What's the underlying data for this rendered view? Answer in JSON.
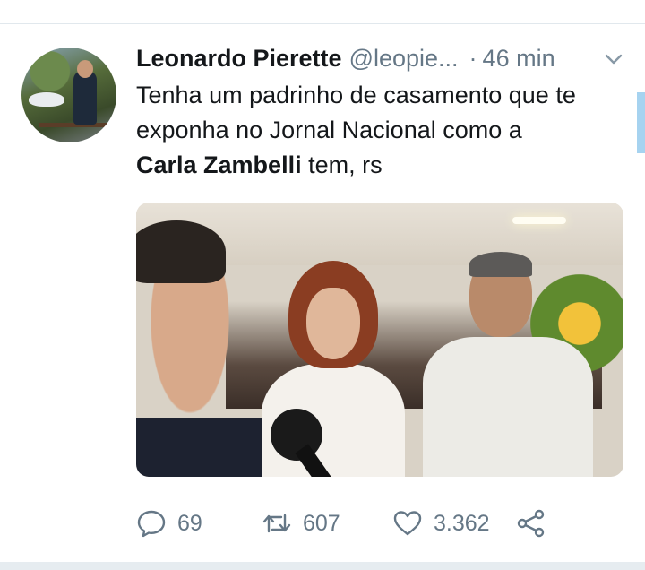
{
  "tweet": {
    "author_name": "Leonardo Pierette",
    "author_handle": "@leopie...",
    "separator": "·",
    "time": "46 min",
    "text_line1": "Tenha um padrinho de casamento que te",
    "text_line2": "exponha no Jornal Nacional como a",
    "text_bold": "Carla Zambelli",
    "text_tail": " tem, rs"
  },
  "actions": {
    "reply_count": "69",
    "retweet_count": "607",
    "like_count": "3.362"
  },
  "icons": {
    "reply": "reply-icon",
    "retweet": "retweet-icon",
    "like": "heart-icon",
    "share": "share-icon",
    "caret": "chevron-down-icon"
  },
  "colors": {
    "text": "#14171a",
    "muted": "#657786",
    "divider": "#e1e8ed",
    "accent": "#a6d3f0"
  }
}
